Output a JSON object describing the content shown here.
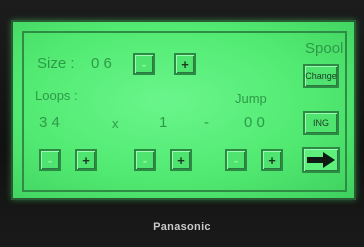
{
  "screen": {
    "title": "Spool",
    "size_label": "Size :",
    "size_value": "0 6",
    "loops_label": "Loops :",
    "loops_value": "3 4",
    "times_symbol": "x",
    "multiplier_value": "1",
    "dash_symbol": "-",
    "jump_label": "Jump",
    "jump_value": "0 0"
  },
  "buttons": {
    "size_minus": "-",
    "size_plus": "+",
    "change": "Change",
    "ing": "ING",
    "loops_minus": "-",
    "loops_plus": "+",
    "mult_minus": "-",
    "mult_plus": "+",
    "jump_minus": "-",
    "jump_plus": "+"
  },
  "icons": {
    "next": "arrow-right-icon"
  },
  "brand": {
    "name": "Panasonic"
  },
  "colors": {
    "screen": "#52ea72",
    "text": "#2e9a47",
    "bezel": "#161616"
  }
}
